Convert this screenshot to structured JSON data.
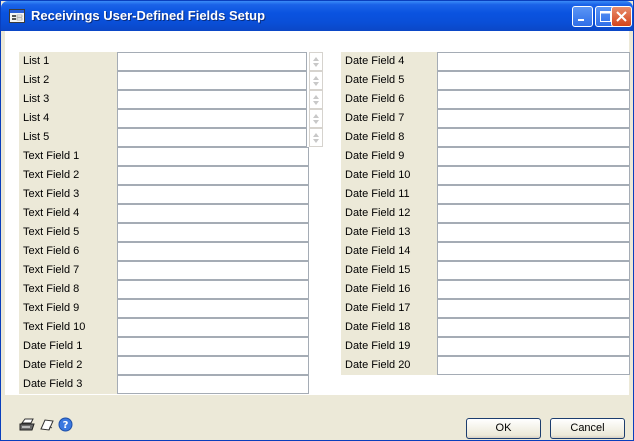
{
  "window": {
    "title": "Receivings User-Defined Fields Setup"
  },
  "left_column": [
    {
      "label": "List 1",
      "value": "",
      "type": "list"
    },
    {
      "label": "List 2",
      "value": "",
      "type": "list"
    },
    {
      "label": "List 3",
      "value": "",
      "type": "list"
    },
    {
      "label": "List 4",
      "value": "",
      "type": "list"
    },
    {
      "label": "List 5",
      "value": "",
      "type": "list"
    },
    {
      "label": "Text Field 1",
      "value": "",
      "type": "text"
    },
    {
      "label": "Text Field 2",
      "value": "",
      "type": "text"
    },
    {
      "label": "Text Field 3",
      "value": "",
      "type": "text"
    },
    {
      "label": "Text Field 4",
      "value": "",
      "type": "text"
    },
    {
      "label": "Text Field 5",
      "value": "",
      "type": "text"
    },
    {
      "label": "Text Field 6",
      "value": "",
      "type": "text"
    },
    {
      "label": "Text Field 7",
      "value": "",
      "type": "text"
    },
    {
      "label": "Text Field 8",
      "value": "",
      "type": "text"
    },
    {
      "label": "Text Field 9",
      "value": "",
      "type": "text"
    },
    {
      "label": "Text Field 10",
      "value": "",
      "type": "text"
    },
    {
      "label": "Date Field 1",
      "value": "",
      "type": "date"
    },
    {
      "label": "Date Field 2",
      "value": "",
      "type": "date"
    },
    {
      "label": "Date Field 3",
      "value": "",
      "type": "date"
    }
  ],
  "right_column": [
    {
      "label": "Date Field 4",
      "value": ""
    },
    {
      "label": "Date Field 5",
      "value": ""
    },
    {
      "label": "Date Field 6",
      "value": ""
    },
    {
      "label": "Date Field 7",
      "value": ""
    },
    {
      "label": "Date Field 8",
      "value": ""
    },
    {
      "label": "Date Field 9",
      "value": ""
    },
    {
      "label": "Date Field 10",
      "value": ""
    },
    {
      "label": "Date Field 11",
      "value": ""
    },
    {
      "label": "Date Field 12",
      "value": ""
    },
    {
      "label": "Date Field 13",
      "value": ""
    },
    {
      "label": "Date Field 14",
      "value": ""
    },
    {
      "label": "Date Field 15",
      "value": ""
    },
    {
      "label": "Date Field 16",
      "value": ""
    },
    {
      "label": "Date Field 17",
      "value": ""
    },
    {
      "label": "Date Field 18",
      "value": ""
    },
    {
      "label": "Date Field 19",
      "value": ""
    },
    {
      "label": "Date Field 20",
      "value": ""
    }
  ],
  "footer": {
    "icons": [
      "printer-icon",
      "note-icon",
      "help-icon"
    ],
    "ok_label": "OK",
    "cancel_label": "Cancel"
  },
  "colors": {
    "titlebar": "#0a4fd8",
    "dialog_bg": "#ece9d8",
    "field_border": "#a5acb5"
  }
}
